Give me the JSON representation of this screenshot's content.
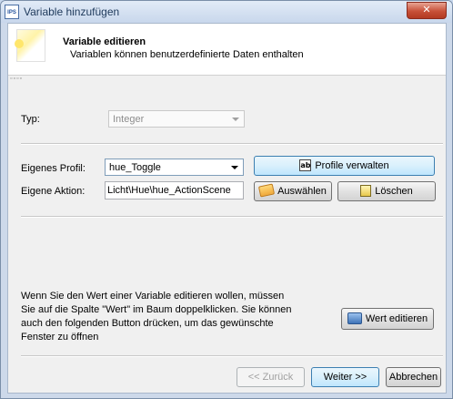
{
  "window": {
    "title": "Variable hinzufügen",
    "app_icon": "IPS",
    "close_glyph": "✕"
  },
  "header": {
    "title": "Variable editieren",
    "subtitle": "Variablen können benutzerdefinierte Daten enthalten",
    "grip": "▫▫▫▫"
  },
  "typ": {
    "label": "Typ:",
    "value": "Integer"
  },
  "profile": {
    "label": "Eigenes Profil:",
    "value": "hue_Toggle",
    "manage_button": "Profile verwalten"
  },
  "action": {
    "label": "Eigene Aktion:",
    "value": "Licht\\Hue\\hue_ActionScene",
    "select_button": "Auswählen",
    "delete_button": "Löschen"
  },
  "info": {
    "text": "Wenn Sie den Wert einer Variable editieren wollen, müssen Sie auf die Spalte \"Wert\" im Baum doppelklicken. Sie können auch den folgenden Button drücken, um das gewünschte Fenster zu öffnen",
    "edit_value_button": "Wert editieren"
  },
  "footer": {
    "back": "<< Zurück",
    "next": "Weiter >>",
    "cancel": "Abbrechen"
  },
  "icons": {
    "manage": "ab-text-icon",
    "select": "folder-icon",
    "delete": "trash-icon",
    "edit_value": "edit-window-icon"
  },
  "colors": {
    "title_text": "#1e395b",
    "close_button": "#c75038",
    "focus_border": "#3c7fb1"
  }
}
